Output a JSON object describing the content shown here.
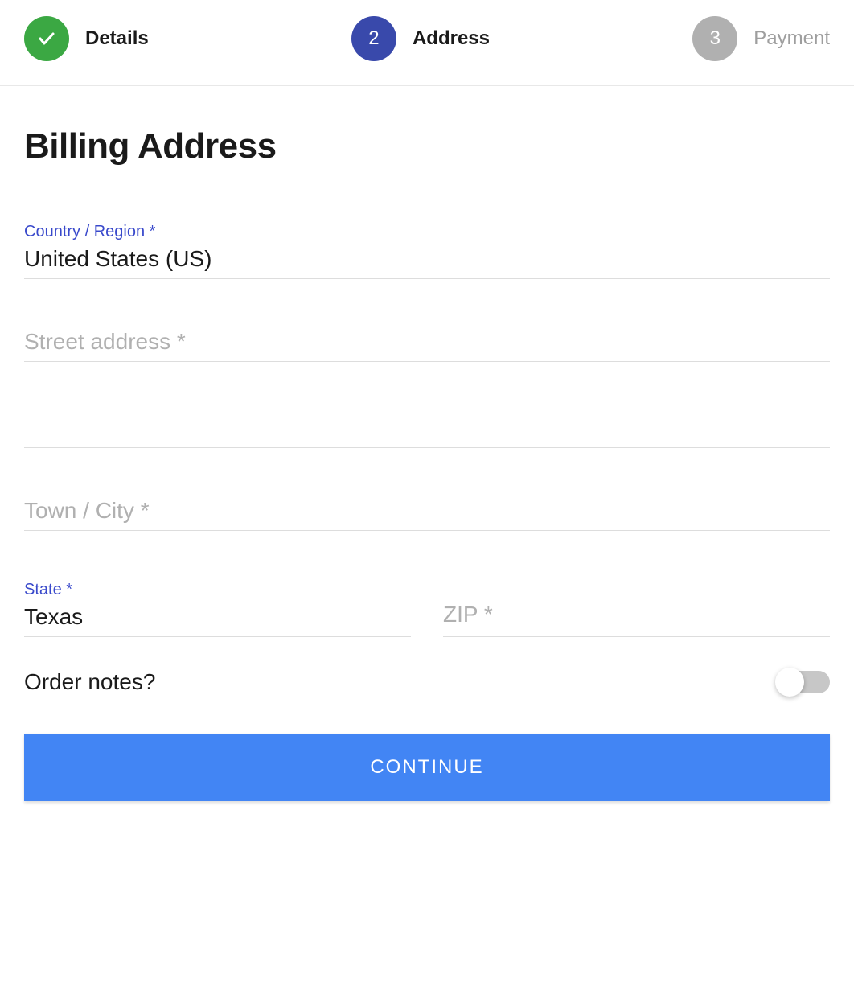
{
  "stepper": {
    "steps": [
      {
        "label": "Details",
        "state": "done"
      },
      {
        "number": "2",
        "label": "Address",
        "state": "active"
      },
      {
        "number": "3",
        "label": "Payment",
        "state": "pending"
      }
    ]
  },
  "page_title": "Billing Address",
  "fields": {
    "country": {
      "label": "Country / Region *",
      "value": "United States (US)"
    },
    "street": {
      "placeholder": "Street address *",
      "value": ""
    },
    "street2": {
      "placeholder": "",
      "value": ""
    },
    "city": {
      "placeholder": "Town / City *",
      "value": ""
    },
    "state": {
      "label": "State *",
      "value": "Texas"
    },
    "zip": {
      "placeholder": "ZIP *",
      "value": ""
    }
  },
  "order_notes": {
    "label": "Order notes?",
    "enabled": false
  },
  "continue_button": "CONTINUE"
}
